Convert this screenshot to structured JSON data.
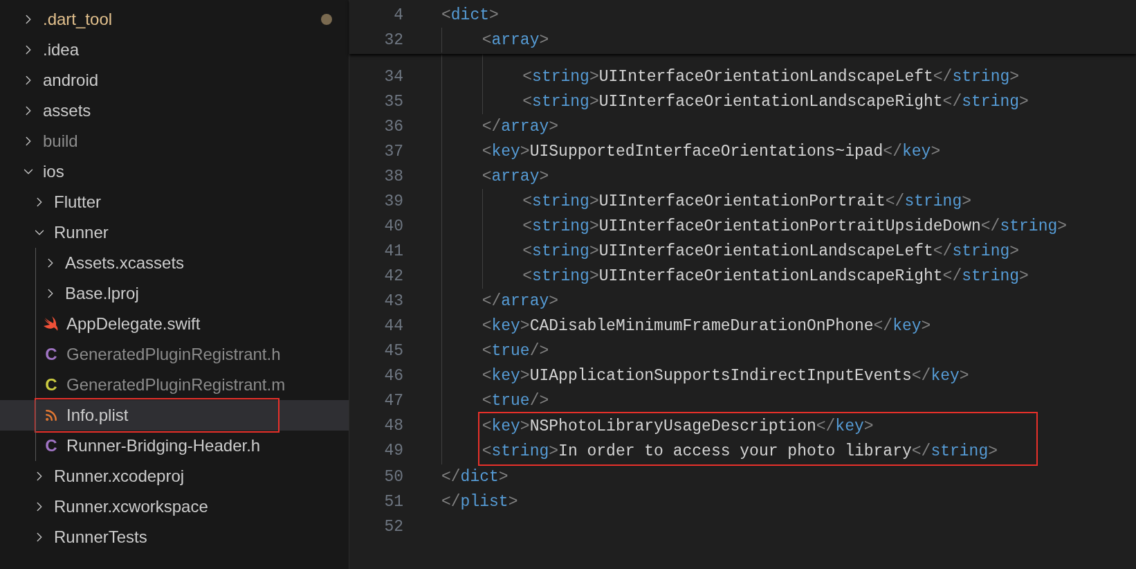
{
  "explorer": {
    "items": [
      {
        "label": ".dart_tool",
        "kind": "folder",
        "expanded": false,
        "modified": true,
        "dimmed": false,
        "selected": false,
        "boxed": false
      },
      {
        "label": ".idea",
        "kind": "folder",
        "expanded": false,
        "modified": false,
        "dimmed": false,
        "selected": false,
        "boxed": false
      },
      {
        "label": "android",
        "kind": "folder",
        "expanded": false,
        "modified": false,
        "dimmed": false,
        "selected": false,
        "boxed": false
      },
      {
        "label": "assets",
        "kind": "folder",
        "expanded": false,
        "modified": false,
        "dimmed": false,
        "selected": false,
        "boxed": false
      },
      {
        "label": "build",
        "kind": "folder",
        "expanded": false,
        "modified": false,
        "dimmed": true,
        "selected": false,
        "boxed": false
      },
      {
        "label": "ios",
        "kind": "folder",
        "expanded": true,
        "modified": false,
        "dimmed": false,
        "selected": false,
        "boxed": false,
        "children": [
          {
            "label": "Flutter",
            "kind": "folder",
            "expanded": false,
            "modified": false,
            "dimmed": false,
            "selected": false,
            "boxed": false
          },
          {
            "label": "Runner",
            "kind": "folder",
            "expanded": true,
            "modified": false,
            "dimmed": false,
            "selected": false,
            "boxed": false,
            "children": [
              {
                "label": "Assets.xcassets",
                "kind": "folder",
                "expanded": false,
                "modified": false,
                "dimmed": false,
                "selected": false,
                "boxed": false
              },
              {
                "label": "Base.lproj",
                "kind": "folder",
                "expanded": false,
                "modified": false,
                "dimmed": false,
                "selected": false,
                "boxed": false
              },
              {
                "label": "AppDelegate.swift",
                "kind": "swift",
                "modified": false,
                "dimmed": false,
                "selected": false,
                "boxed": false
              },
              {
                "label": "GeneratedPluginRegistrant.h",
                "kind": "letter",
                "icon_text": "C",
                "color": "#a074c4",
                "modified": false,
                "dimmed": true,
                "selected": false,
                "boxed": false
              },
              {
                "label": "GeneratedPluginRegistrant.m",
                "kind": "letter",
                "icon_text": "C",
                "color": "#cbcb41",
                "modified": false,
                "dimmed": true,
                "selected": false,
                "boxed": false
              },
              {
                "label": "Info.plist",
                "kind": "feed",
                "modified": false,
                "dimmed": false,
                "selected": true,
                "boxed": true
              },
              {
                "label": "Runner-Bridging-Header.h",
                "kind": "letter",
                "icon_text": "C",
                "color": "#a074c4",
                "modified": false,
                "dimmed": false,
                "selected": false,
                "boxed": false
              }
            ]
          },
          {
            "label": "Runner.xcodeproj",
            "kind": "folder",
            "expanded": false,
            "modified": false,
            "dimmed": false,
            "selected": false,
            "boxed": false
          },
          {
            "label": "Runner.xcworkspace",
            "kind": "folder",
            "expanded": false,
            "modified": false,
            "dimmed": false,
            "selected": false,
            "boxed": false
          },
          {
            "label": "RunnerTests",
            "kind": "folder",
            "expanded": false,
            "modified": false,
            "dimmed": false,
            "selected": false,
            "boxed": false
          }
        ]
      }
    ]
  },
  "editor": {
    "sticky_lines": [
      {
        "kind": "line",
        "number": "4",
        "boxed": false,
        "tokens": [
          {
            "kind": "punct",
            "text": "<"
          },
          {
            "kind": "tag",
            "text": "dict"
          },
          {
            "kind": "punct",
            "text": ">"
          }
        ],
        "children": [
          {
            "kind": "line",
            "number": "32",
            "boxed": false,
            "tokens": [
              {
                "kind": "punct",
                "text": "<"
              },
              {
                "kind": "tag",
                "text": "array"
              },
              {
                "kind": "punct",
                "text": ">"
              }
            ]
          }
        ]
      }
    ],
    "lines": [
      {
        "kind": "block",
        "children": [
          {
            "kind": "block",
            "children": [
              {
                "kind": "line",
                "number": "34",
                "boxed": false,
                "tokens": [
                  {
                    "kind": "punct",
                    "text": "<"
                  },
                  {
                    "kind": "tag",
                    "text": "string"
                  },
                  {
                    "kind": "punct",
                    "text": ">"
                  },
                  {
                    "kind": "text",
                    "text": "UIInterfaceOrientationLandscapeLeft"
                  },
                  {
                    "kind": "punct",
                    "text": "</"
                  },
                  {
                    "kind": "tag",
                    "text": "string"
                  },
                  {
                    "kind": "punct",
                    "text": ">"
                  }
                ]
              },
              {
                "kind": "line",
                "number": "35",
                "boxed": false,
                "tokens": [
                  {
                    "kind": "punct",
                    "text": "<"
                  },
                  {
                    "kind": "tag",
                    "text": "string"
                  },
                  {
                    "kind": "punct",
                    "text": ">"
                  },
                  {
                    "kind": "text",
                    "text": "UIInterfaceOrientationLandscapeRight"
                  },
                  {
                    "kind": "punct",
                    "text": "</"
                  },
                  {
                    "kind": "tag",
                    "text": "string"
                  },
                  {
                    "kind": "punct",
                    "text": ">"
                  }
                ]
              }
            ]
          },
          {
            "kind": "line",
            "number": "36",
            "boxed": false,
            "tokens": [
              {
                "kind": "punct",
                "text": "</"
              },
              {
                "kind": "tag",
                "text": "array"
              },
              {
                "kind": "punct",
                "text": ">"
              }
            ]
          },
          {
            "kind": "line",
            "number": "37",
            "boxed": false,
            "tokens": [
              {
                "kind": "punct",
                "text": "<"
              },
              {
                "kind": "tag",
                "text": "key"
              },
              {
                "kind": "punct",
                "text": ">"
              },
              {
                "kind": "text",
                "text": "UISupportedInterfaceOrientations~ipad"
              },
              {
                "kind": "punct",
                "text": "</"
              },
              {
                "kind": "tag",
                "text": "key"
              },
              {
                "kind": "punct",
                "text": ">"
              }
            ]
          },
          {
            "kind": "line",
            "number": "38",
            "boxed": false,
            "tokens": [
              {
                "kind": "punct",
                "text": "<"
              },
              {
                "kind": "tag",
                "text": "array"
              },
              {
                "kind": "punct",
                "text": ">"
              }
            ],
            "children": [
              {
                "kind": "line",
                "number": "39",
                "boxed": false,
                "tokens": [
                  {
                    "kind": "punct",
                    "text": "<"
                  },
                  {
                    "kind": "tag",
                    "text": "string"
                  },
                  {
                    "kind": "punct",
                    "text": ">"
                  },
                  {
                    "kind": "text",
                    "text": "UIInterfaceOrientationPortrait"
                  },
                  {
                    "kind": "punct",
                    "text": "</"
                  },
                  {
                    "kind": "tag",
                    "text": "string"
                  },
                  {
                    "kind": "punct",
                    "text": ">"
                  }
                ]
              },
              {
                "kind": "line",
                "number": "40",
                "boxed": false,
                "tokens": [
                  {
                    "kind": "punct",
                    "text": "<"
                  },
                  {
                    "kind": "tag",
                    "text": "string"
                  },
                  {
                    "kind": "punct",
                    "text": ">"
                  },
                  {
                    "kind": "text",
                    "text": "UIInterfaceOrientationPortraitUpsideDown"
                  },
                  {
                    "kind": "punct",
                    "text": "</"
                  },
                  {
                    "kind": "tag",
                    "text": "string"
                  },
                  {
                    "kind": "punct",
                    "text": ">"
                  }
                ]
              },
              {
                "kind": "line",
                "number": "41",
                "boxed": false,
                "tokens": [
                  {
                    "kind": "punct",
                    "text": "<"
                  },
                  {
                    "kind": "tag",
                    "text": "string"
                  },
                  {
                    "kind": "punct",
                    "text": ">"
                  },
                  {
                    "kind": "text",
                    "text": "UIInterfaceOrientationLandscapeLeft"
                  },
                  {
                    "kind": "punct",
                    "text": "</"
                  },
                  {
                    "kind": "tag",
                    "text": "string"
                  },
                  {
                    "kind": "punct",
                    "text": ">"
                  }
                ]
              },
              {
                "kind": "line",
                "number": "42",
                "boxed": false,
                "tokens": [
                  {
                    "kind": "punct",
                    "text": "<"
                  },
                  {
                    "kind": "tag",
                    "text": "string"
                  },
                  {
                    "kind": "punct",
                    "text": ">"
                  },
                  {
                    "kind": "text",
                    "text": "UIInterfaceOrientationLandscapeRight"
                  },
                  {
                    "kind": "punct",
                    "text": "</"
                  },
                  {
                    "kind": "tag",
                    "text": "string"
                  },
                  {
                    "kind": "punct",
                    "text": ">"
                  }
                ]
              }
            ]
          },
          {
            "kind": "line",
            "number": "43",
            "boxed": false,
            "tokens": [
              {
                "kind": "punct",
                "text": "</"
              },
              {
                "kind": "tag",
                "text": "array"
              },
              {
                "kind": "punct",
                "text": ">"
              }
            ]
          },
          {
            "kind": "line",
            "number": "44",
            "boxed": false,
            "tokens": [
              {
                "kind": "punct",
                "text": "<"
              },
              {
                "kind": "tag",
                "text": "key"
              },
              {
                "kind": "punct",
                "text": ">"
              },
              {
                "kind": "text",
                "text": "CADisableMinimumFrameDurationOnPhone"
              },
              {
                "kind": "punct",
                "text": "</"
              },
              {
                "kind": "tag",
                "text": "key"
              },
              {
                "kind": "punct",
                "text": ">"
              }
            ]
          },
          {
            "kind": "line",
            "number": "45",
            "boxed": false,
            "tokens": [
              {
                "kind": "punct",
                "text": "<"
              },
              {
                "kind": "tag",
                "text": "true"
              },
              {
                "kind": "punct",
                "text": "/>"
              }
            ]
          },
          {
            "kind": "line",
            "number": "46",
            "boxed": false,
            "tokens": [
              {
                "kind": "punct",
                "text": "<"
              },
              {
                "kind": "tag",
                "text": "key"
              },
              {
                "kind": "punct",
                "text": ">"
              },
              {
                "kind": "text",
                "text": "UIApplicationSupportsIndirectInputEvents"
              },
              {
                "kind": "punct",
                "text": "</"
              },
              {
                "kind": "tag",
                "text": "key"
              },
              {
                "kind": "punct",
                "text": ">"
              }
            ]
          },
          {
            "kind": "line",
            "number": "47",
            "boxed": false,
            "tokens": [
              {
                "kind": "punct",
                "text": "<"
              },
              {
                "kind": "tag",
                "text": "true"
              },
              {
                "kind": "punct",
                "text": "/>"
              }
            ]
          },
          {
            "kind": "line",
            "number": "48",
            "boxed": true,
            "tokens": [
              {
                "kind": "punct",
                "text": "<"
              },
              {
                "kind": "tag",
                "text": "key"
              },
              {
                "kind": "punct",
                "text": ">"
              },
              {
                "kind": "text",
                "text": "NSPhotoLibraryUsageDescription"
              },
              {
                "kind": "punct",
                "text": "</"
              },
              {
                "kind": "tag",
                "text": "key"
              },
              {
                "kind": "punct",
                "text": ">"
              }
            ]
          },
          {
            "kind": "line",
            "number": "49",
            "boxed": true,
            "tokens": [
              {
                "kind": "punct",
                "text": "<"
              },
              {
                "kind": "tag",
                "text": "string"
              },
              {
                "kind": "punct",
                "text": ">"
              },
              {
                "kind": "text",
                "text": "In order to access your photo library"
              },
              {
                "kind": "punct",
                "text": "</"
              },
              {
                "kind": "tag",
                "text": "string"
              },
              {
                "kind": "punct",
                "text": ">"
              }
            ]
          }
        ]
      },
      {
        "kind": "line",
        "number": "50",
        "boxed": false,
        "tokens": [
          {
            "kind": "punct",
            "text": "</"
          },
          {
            "kind": "tag",
            "text": "dict"
          },
          {
            "kind": "punct",
            "text": ">"
          }
        ]
      },
      {
        "kind": "line",
        "number": "51",
        "boxed": false,
        "tokens": [
          {
            "kind": "punct",
            "text": "</"
          },
          {
            "kind": "tag",
            "text": "plist"
          },
          {
            "kind": "punct",
            "text": ">"
          }
        ]
      },
      {
        "kind": "line",
        "number": "52",
        "boxed": false
      }
    ]
  }
}
